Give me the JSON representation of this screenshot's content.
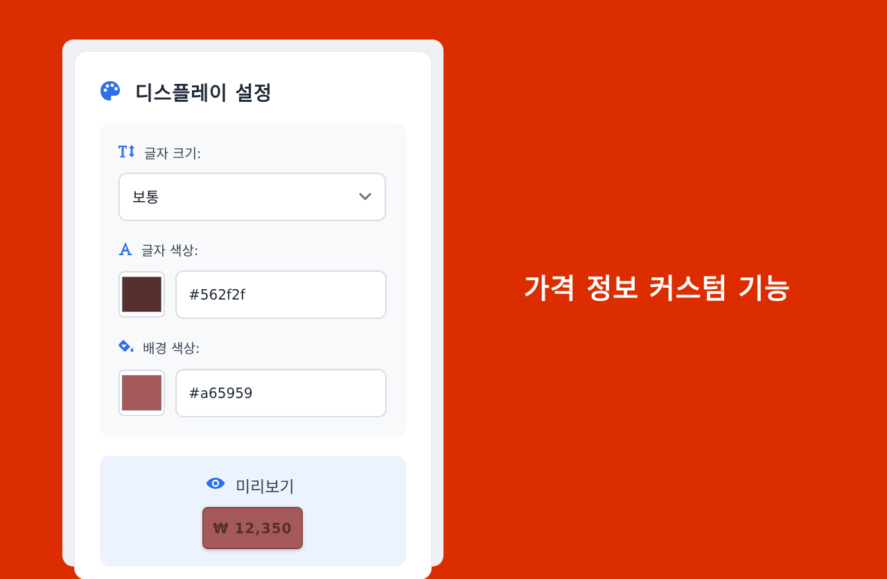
{
  "headline": "가격 정보 커스텀 기능",
  "colors": {
    "background": "#dc2d00",
    "accent_icon": "#2f6fe8",
    "text_color_value": "#562f2f",
    "bg_color_value": "#a65959"
  },
  "panel": {
    "title": "디스플레이 설정",
    "title_icon": "palette-icon",
    "font_size": {
      "label": "글자 크기:",
      "icon": "text-height-icon",
      "selected": "보통",
      "chevron_icon": "chevron-down-icon"
    },
    "text_color": {
      "label": "글자 색상:",
      "icon": "font-letter-icon",
      "value": "#562f2f"
    },
    "bg_color": {
      "label": "배경 색상:",
      "icon": "paint-bucket-icon",
      "value": "#a65959"
    },
    "preview": {
      "label": "미리보기",
      "icon": "eye-icon",
      "price": "₩ 12,350"
    }
  }
}
